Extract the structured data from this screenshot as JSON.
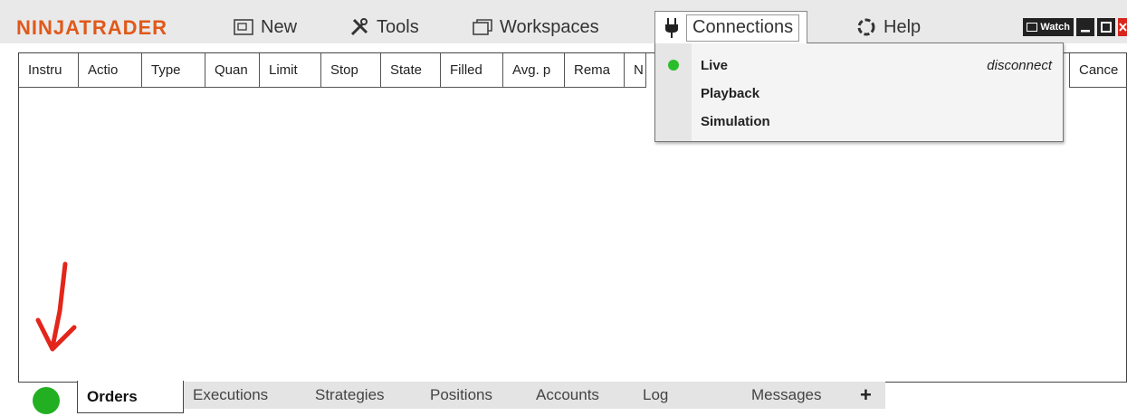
{
  "app": {
    "logo": "NINJATRADER"
  },
  "menu": {
    "new": "New",
    "tools": "Tools",
    "workspaces": "Workspaces",
    "connections": "Connections",
    "help": "Help",
    "watch": "Watch"
  },
  "columns": [
    "Instru",
    "Actio",
    "Type",
    "Quan",
    "Limit",
    "Stop",
    "State",
    "Filled",
    "Avg. p",
    "Rema",
    "N",
    "Cance"
  ],
  "connections_menu": {
    "items": [
      {
        "label": "Live",
        "status": "connected",
        "aside": "disconnect"
      },
      {
        "label": "Playback"
      },
      {
        "label": "Simulation"
      }
    ]
  },
  "tabs": [
    "Orders",
    "Executions",
    "Strategies",
    "Positions",
    "Accounts",
    "Log",
    "Messages",
    "+"
  ],
  "active_tab": "Orders",
  "colors": {
    "brand": "#e0591a",
    "status_green": "#22b022",
    "annotation_red": "#e3261b"
  }
}
